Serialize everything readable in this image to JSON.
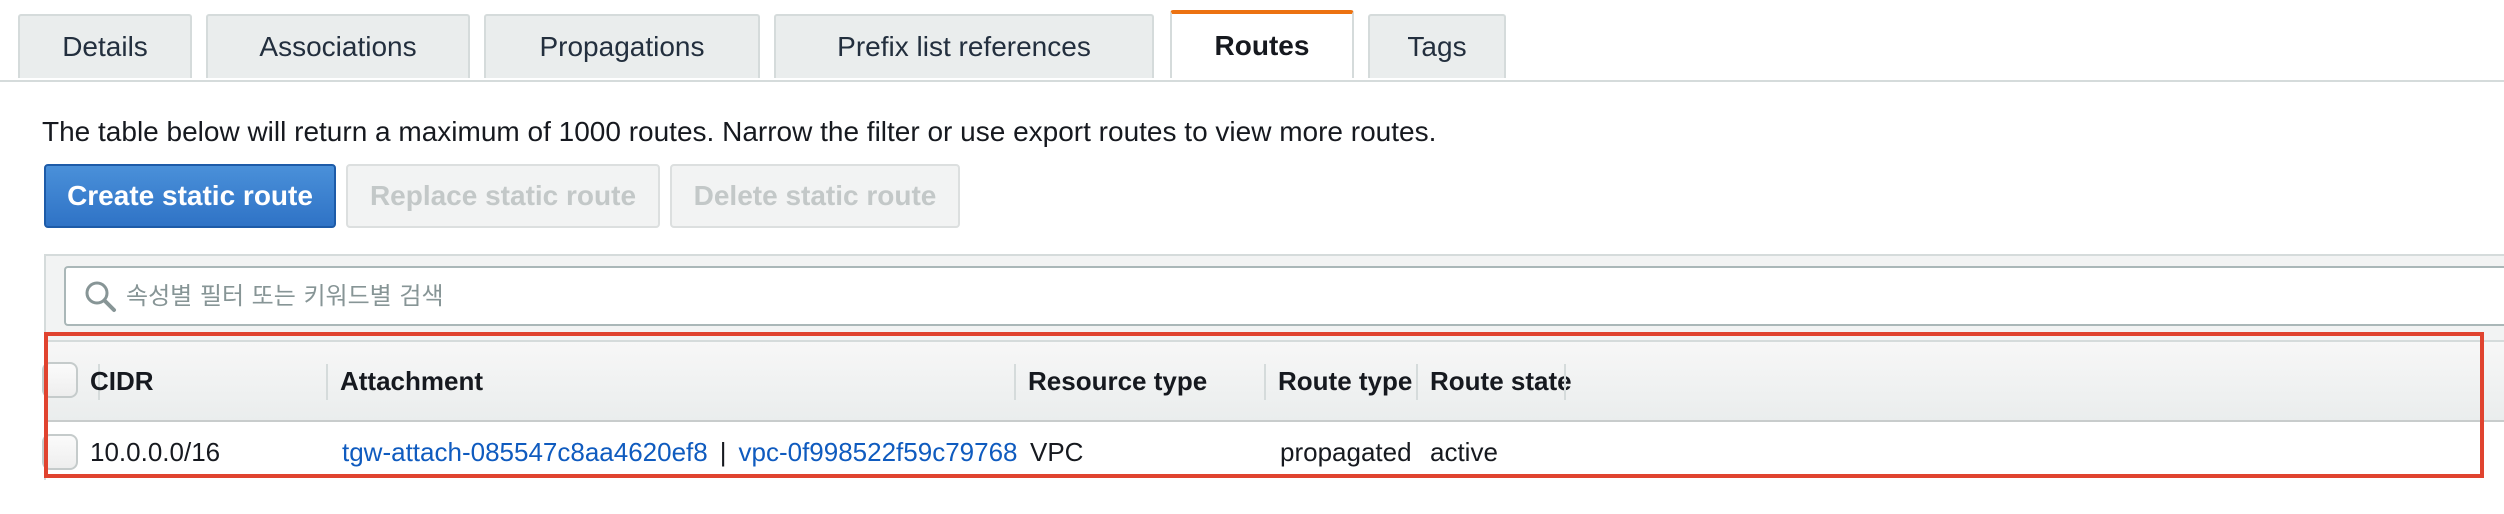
{
  "tabs": [
    {
      "label": "Details",
      "active": false
    },
    {
      "label": "Associations",
      "active": false
    },
    {
      "label": "Propagations",
      "active": false
    },
    {
      "label": "Prefix list references",
      "active": false
    },
    {
      "label": "Routes",
      "active": true
    },
    {
      "label": "Tags",
      "active": false
    }
  ],
  "info_text": "The table below will return a maximum of 1000 routes. Narrow the filter or use export routes to view more routes.",
  "actions": {
    "create_label": "Create static route",
    "replace_label": "Replace static route",
    "delete_label": "Delete static route"
  },
  "search": {
    "placeholder": "속성별 필터 또는 키워드별 검색",
    "icon": "search-icon"
  },
  "table": {
    "columns": [
      "CIDR",
      "Attachment",
      "Resource type",
      "Route type",
      "Route state"
    ],
    "rows": [
      {
        "cidr": "10.0.0.0/16",
        "attachment_id": "tgw-attach-085547c8aa4620ef8",
        "separator": "|",
        "vpc_id": "vpc-0f998522f59c79768",
        "resource_type": "VPC",
        "route_type": "propagated",
        "route_state": "active"
      }
    ]
  },
  "colors": {
    "accent_tab": "#ec7211",
    "primary_button": "#2f73c6",
    "link": "#0f5bbf",
    "highlight_box": "#e0432f"
  }
}
